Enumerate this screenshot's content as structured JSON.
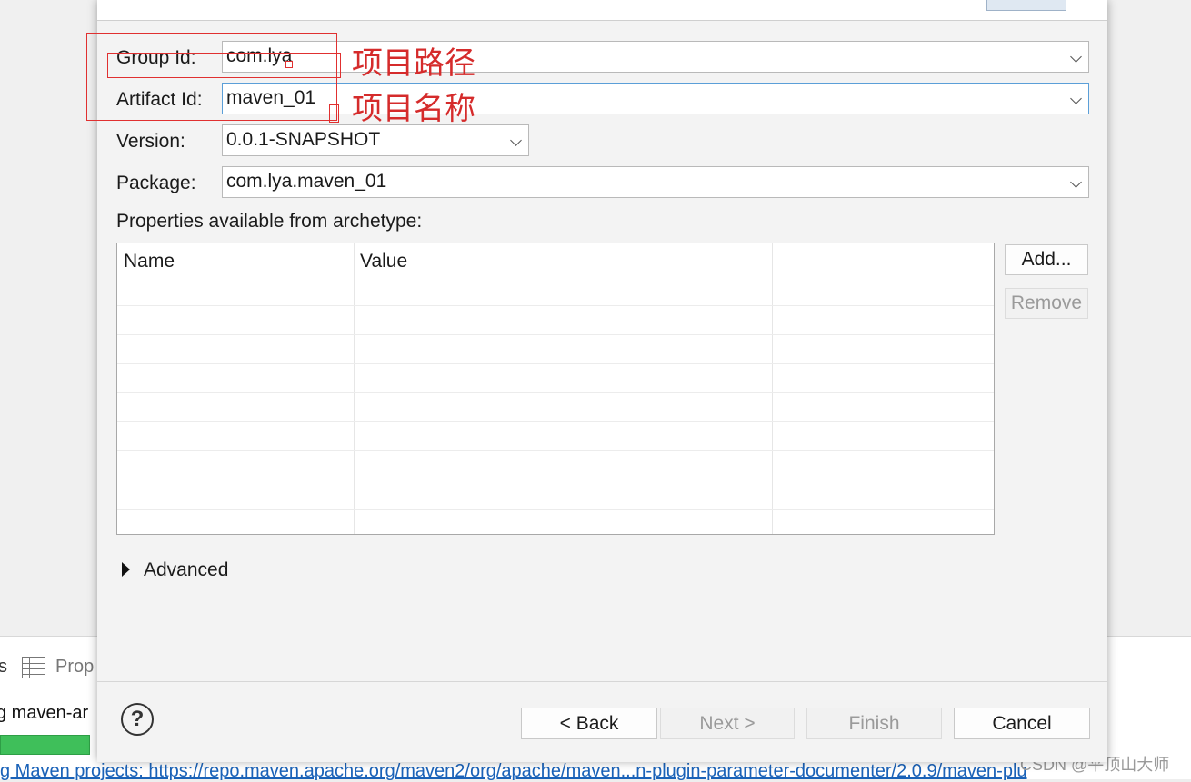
{
  "background": {
    "views_tab_partial_left": "s",
    "views_tab_partial": "Prop",
    "status_partial": "g maven-ar",
    "link_partial": "g Maven projects: https://repo.maven.apache.org/maven2/org/apache/maven...n-plugin-parameter-documenter/2.0.9/maven-plu",
    "progress": 1.0,
    "watermark": "CSDN @平顶山大师",
    "progress_color": "#3fbf5a",
    "link_color": "#1a62b8"
  },
  "form": {
    "group_id_label": "Group Id:",
    "group_id_value": "com.lya",
    "artifact_id_label": "Artifact Id:",
    "artifact_id_value": "maven_01",
    "version_label": "Version:",
    "version_value": "0.0.1-SNAPSHOT",
    "package_label": "Package:",
    "package_value": "com.lya.maven_01",
    "properties_label": "Properties available from archetype:"
  },
  "properties_table": {
    "columns": [
      "Name",
      "Value",
      ""
    ],
    "rows": []
  },
  "side_buttons": {
    "add": "Add...",
    "remove": "Remove"
  },
  "advanced_label": "Advanced",
  "footer": {
    "help": "?",
    "back": "< Back",
    "next": "Next >",
    "finish": "Finish",
    "cancel": "Cancel"
  },
  "annotations": {
    "group_note": "项目路径",
    "artifact_note": "项目名称",
    "color": "#d52b2b"
  },
  "icons": [
    "help-icon",
    "dropdown-arrow-icon",
    "expand-triangle-icon",
    "properties-view-icon"
  ]
}
